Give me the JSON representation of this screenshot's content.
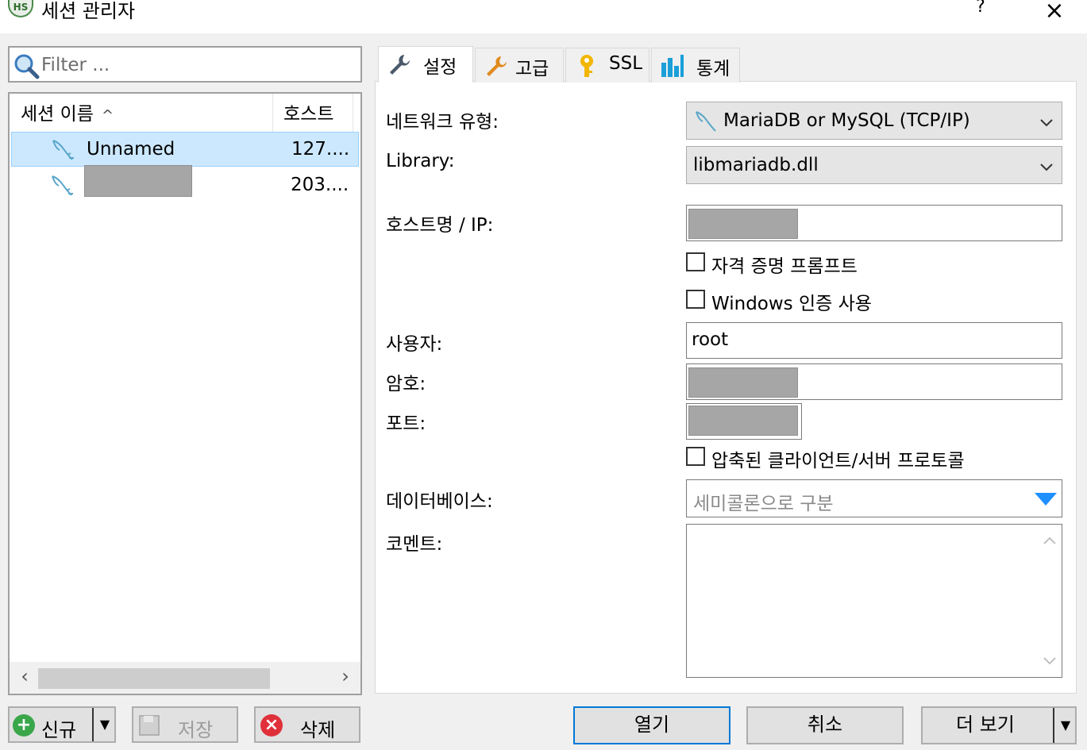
{
  "window": {
    "icon_text": "HS",
    "title": "세션 관리자",
    "help": "?",
    "close": "×"
  },
  "filter": {
    "placeholder": "Filter ..."
  },
  "session_list": {
    "columns": [
      "세션 이름",
      "호스트"
    ],
    "rows": [
      {
        "name": "Unnamed",
        "host": "127....",
        "selected": true
      },
      {
        "name": "",
        "host": "203....",
        "selected": false,
        "name_redacted": true
      }
    ]
  },
  "left_buttons": {
    "new": "신규",
    "save": "저장",
    "delete": "삭제"
  },
  "tabs": [
    {
      "label": "설정",
      "icon": "wrench-icon",
      "active": true
    },
    {
      "label": "고급",
      "icon": "wrench-orange-icon",
      "active": false
    },
    {
      "label": "SSL",
      "icon": "key-icon",
      "active": false
    },
    {
      "label": "통계",
      "icon": "bar-chart-icon",
      "active": false
    }
  ],
  "settings": {
    "network_type_label": "네트워크 유형:",
    "network_type_value": "MariaDB or MySQL (TCP/IP)",
    "library_label": "Library:",
    "library_value": "libmariadb.dll",
    "host_label": "호스트명 / IP:",
    "credentials_prompt": "자격 증명 프롬프트",
    "windows_auth": "Windows 인증 사용",
    "user_label": "사용자:",
    "user_value": "root",
    "password_label": "암호:",
    "port_label": "포트:",
    "compressed_protocol": "압축된 클라이언트/서버 프로토콜",
    "database_label": "데이터베이스:",
    "database_placeholder": "세미콜론으로 구분",
    "comment_label": "코멘트:"
  },
  "footer_buttons": {
    "open": "열기",
    "cancel": "취소",
    "more": "더 보기"
  },
  "colors": {
    "selection": "#cce8ff",
    "accent_blue": "#1e90ff",
    "tab_orange": "#e08a1e",
    "key_yellow": "#f2b600",
    "chart_teal": "#1a9fd9"
  }
}
